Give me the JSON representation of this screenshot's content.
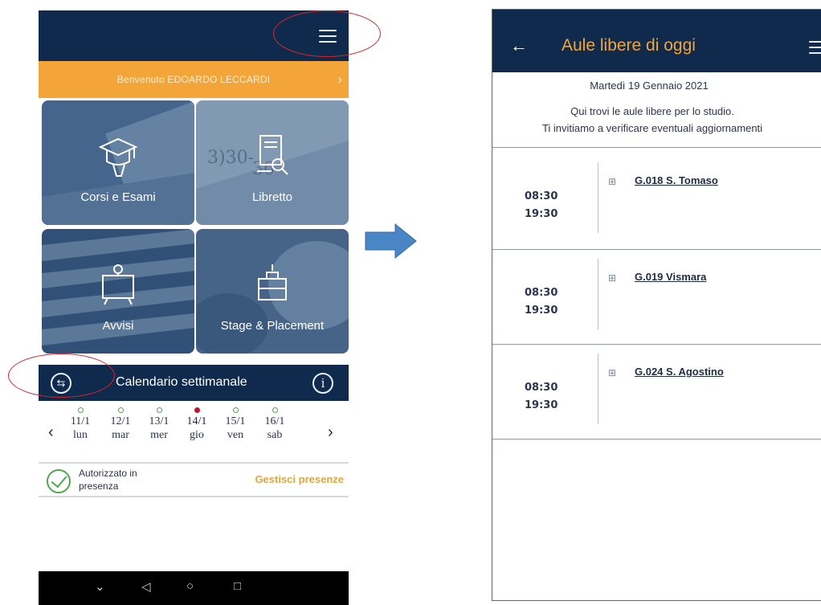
{
  "home": {
    "welcome": "Benvenuto EDOARDO LECCARDI",
    "tiles": [
      {
        "label": "Corsi e Esami",
        "icon": "graduation-cap-icon"
      },
      {
        "label": "Libretto",
        "icon": "notebook-search-icon"
      },
      {
        "label": "Avvisi",
        "icon": "board-notice-icon"
      },
      {
        "label": "Stage & Placement",
        "icon": "briefcase-tools-icon"
      }
    ],
    "calendar_title": "Calendario settimanale",
    "days": [
      {
        "date": "11/1",
        "name": "lun"
      },
      {
        "date": "12/1",
        "name": "mar"
      },
      {
        "date": "13/1",
        "name": "mer"
      },
      {
        "date": "14/1",
        "name": "gio"
      },
      {
        "date": "15/1",
        "name": "ven"
      },
      {
        "date": "16/1",
        "name": "sab"
      }
    ],
    "presence_status": "Autorizzato in presenza",
    "presence_action": "Gestisci presenze"
  },
  "classrooms": {
    "title": "Aule libere di oggi",
    "date": "Martedì 19 Gennaio 2021",
    "info_line1": "Qui trovi le aule libere per lo studio.",
    "info_line2": "Ti invitiamo a verificare eventuali aggiornamenti",
    "rooms": [
      {
        "start": "08:30",
        "end": "19:30",
        "name": "G.018 S. Tomaso"
      },
      {
        "start": "08:30",
        "end": "19:30",
        "name": "G.019 Vismara"
      },
      {
        "start": "08:30",
        "end": "19:30",
        "name": "G.024 S. Agostino"
      }
    ]
  },
  "colors": {
    "navy": "#0f2a4d",
    "orange": "#f4a53a",
    "annotation_red": "#d5262e",
    "arrow_blue": "#4a86c6",
    "presence_green": "#4fa84f"
  }
}
